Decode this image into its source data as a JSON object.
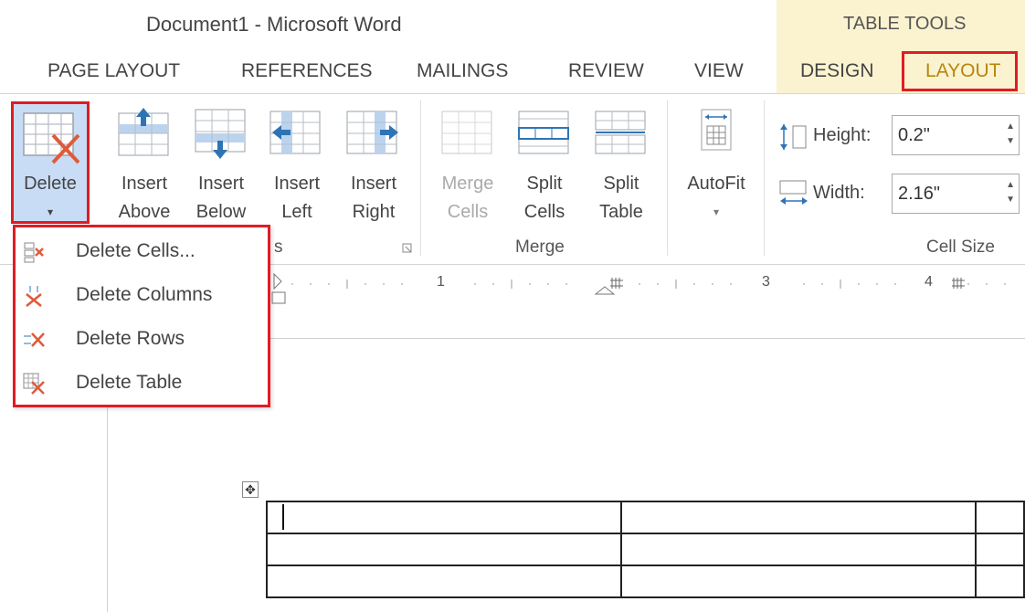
{
  "window": {
    "title": "Document1 - Microsoft Word"
  },
  "contextual": {
    "label": "TABLE TOOLS"
  },
  "tabs": [
    {
      "label": "PAGE LAYOUT"
    },
    {
      "label": "REFERENCES"
    },
    {
      "label": "MAILINGS"
    },
    {
      "label": "REVIEW"
    },
    {
      "label": "VIEW"
    },
    {
      "label": "DESIGN"
    },
    {
      "label": "LAYOUT"
    }
  ],
  "ribbon": {
    "delete": {
      "line1": "Delete",
      "line2": "▾"
    },
    "insert_above": {
      "line1": "Insert",
      "line2": "Above"
    },
    "insert_below": {
      "line1": "Insert",
      "line2": "Below"
    },
    "insert_left": {
      "line1": "Insert",
      "line2": "Left"
    },
    "insert_right": {
      "line1": "Insert",
      "line2": "Right"
    },
    "merge_cells": {
      "line1": "Merge",
      "line2": "Cells"
    },
    "split_cells": {
      "line1": "Split",
      "line2": "Cells"
    },
    "split_table": {
      "line1": "Split",
      "line2": "Table"
    },
    "autofit": {
      "line1": "AutoFit",
      "line2": "▾"
    },
    "groups": {
      "rows_cols_tail": "s",
      "merge": "Merge",
      "cell_size": "Cell Size"
    },
    "height": {
      "label": "Height:",
      "value": "0.2\""
    },
    "width": {
      "label": "Width:",
      "value": "2.16\""
    }
  },
  "ruler": {
    "marks": [
      "1",
      "3",
      "4"
    ]
  },
  "delete_menu": {
    "items": [
      {
        "label": "Delete Cells...",
        "icon": "delete-cells-icon"
      },
      {
        "label": "Delete Columns",
        "icon": "delete-columns-icon"
      },
      {
        "label": "Delete Rows",
        "icon": "delete-rows-icon"
      },
      {
        "label": "Delete Table",
        "icon": "delete-table-icon"
      }
    ]
  },
  "colors": {
    "highlight": "#e01c24",
    "contextual_bg": "#fbf3d0",
    "accent_icon": "#2e74b5",
    "delete_x": "#e05a3a"
  }
}
